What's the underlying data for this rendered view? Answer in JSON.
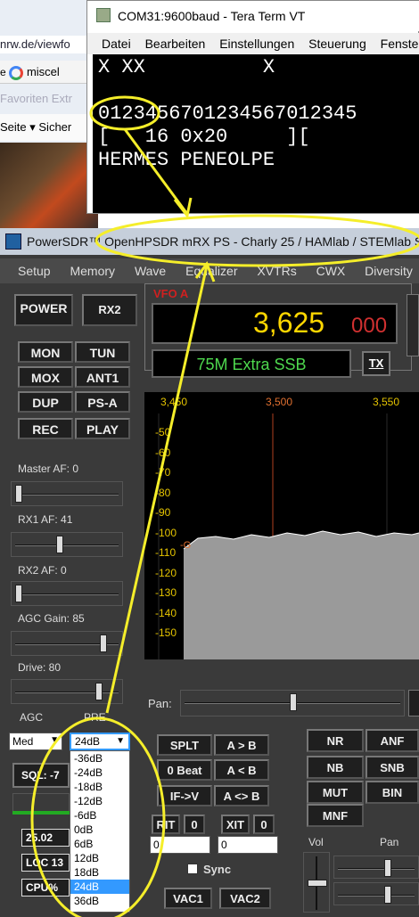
{
  "browser": {
    "url": "nrw.de/viewfo",
    "tab": "miscel",
    "favorites": "Favoriten   Extr",
    "menu": "Seite ▾   Sicher"
  },
  "teraterm": {
    "title": "COM31:9600baud - Tera Term VT",
    "menu": [
      "Datei",
      "Bearbeiten",
      "Einstellungen",
      "Steuerung",
      "Fenste"
    ],
    "lines": [
      "X XX          X",
      "",
      "0123456701234567012345",
      "[   16 0x20     ][",
      "HERMES PENEOLPE"
    ]
  },
  "psdr": {
    "title": "PowerSDR™ OpenHPSDR mRX PS  - Charly 25 / HAMlab / STEMlab S",
    "menu": [
      "Setup",
      "Memory",
      "Wave",
      "Equalizer",
      "XVTRs",
      "CWX",
      "Diversity"
    ],
    "buttons": {
      "power": "POWER",
      "rx2": "RX2",
      "mon": "MON",
      "tun": "TUN",
      "mox": "MOX",
      "ant1": "ANT1",
      "dup": "DUP",
      "psa": "PS-A",
      "rec": "REC",
      "play": "PLAY"
    },
    "sliders": {
      "master_af": "Master AF:  0",
      "rx1_af": "RX1 AF:  41",
      "rx2_af": "RX2 AF:  0",
      "agc_gain": "AGC Gain:  85",
      "drive": "Drive:  80"
    },
    "levels": {
      "master_af": 0.0,
      "rx1_af": 0.41,
      "rx2_af": 0.0,
      "agc_gain": 0.85,
      "drive": 0.8
    },
    "vfo": {
      "label": "VFO A",
      "freq_main": "3,625",
      "freq_sub": "000",
      "mode": "75M Extra SSB",
      "tx": "TX"
    },
    "pan": {
      "freq_ticks": [
        "3,450",
        "3,500",
        "3,550"
      ],
      "db_ticks": [
        "-50",
        "-60",
        "-70",
        "-80",
        "-90",
        "-100",
        "-110",
        "-120",
        "-130",
        "-140",
        "-150"
      ],
      "marker": "-G"
    },
    "agc": {
      "label": "AGC",
      "value": "Med"
    },
    "pre": {
      "label": "PRE",
      "value": "24dB"
    },
    "preamp_options": [
      "-36dB",
      "-24dB",
      "-18dB",
      "-12dB",
      "-6dB",
      "0dB",
      "6dB",
      "12dB",
      "18dB",
      "24dB",
      "36dB"
    ],
    "preamp_selected": "24dB",
    "sql": "SQL:  -7",
    "readouts": [
      "25.02",
      "LOC 13",
      "CPU%"
    ],
    "pan_label": "Pan:",
    "right_buttons": {
      "splt": "SPLT",
      "a_to_b": "A > B",
      "beat": "0 Beat",
      "b_to_a": "A < B",
      "if_v": "IF->V",
      "swap": "A <> B",
      "rit": "RIT",
      "rit_val": "0",
      "xit": "XIT",
      "xit_val": "0",
      "rit_num": "0",
      "xit_num": "0",
      "nr": "NR",
      "anf": "ANF",
      "nb": "NB",
      "snb": "SNB",
      "mut": "MUT",
      "bin": "BIN",
      "mnf": "MNF",
      "sync": "Sync",
      "vac1": "VAC1",
      "vac2": "VAC2",
      "vol": "Vol",
      "pan": "Pan"
    }
  },
  "colors": {
    "accent": "#f5ee2a",
    "freq": "#ffd700",
    "mode_text": "#4ed94e",
    "sub_freq": "#d03030"
  }
}
